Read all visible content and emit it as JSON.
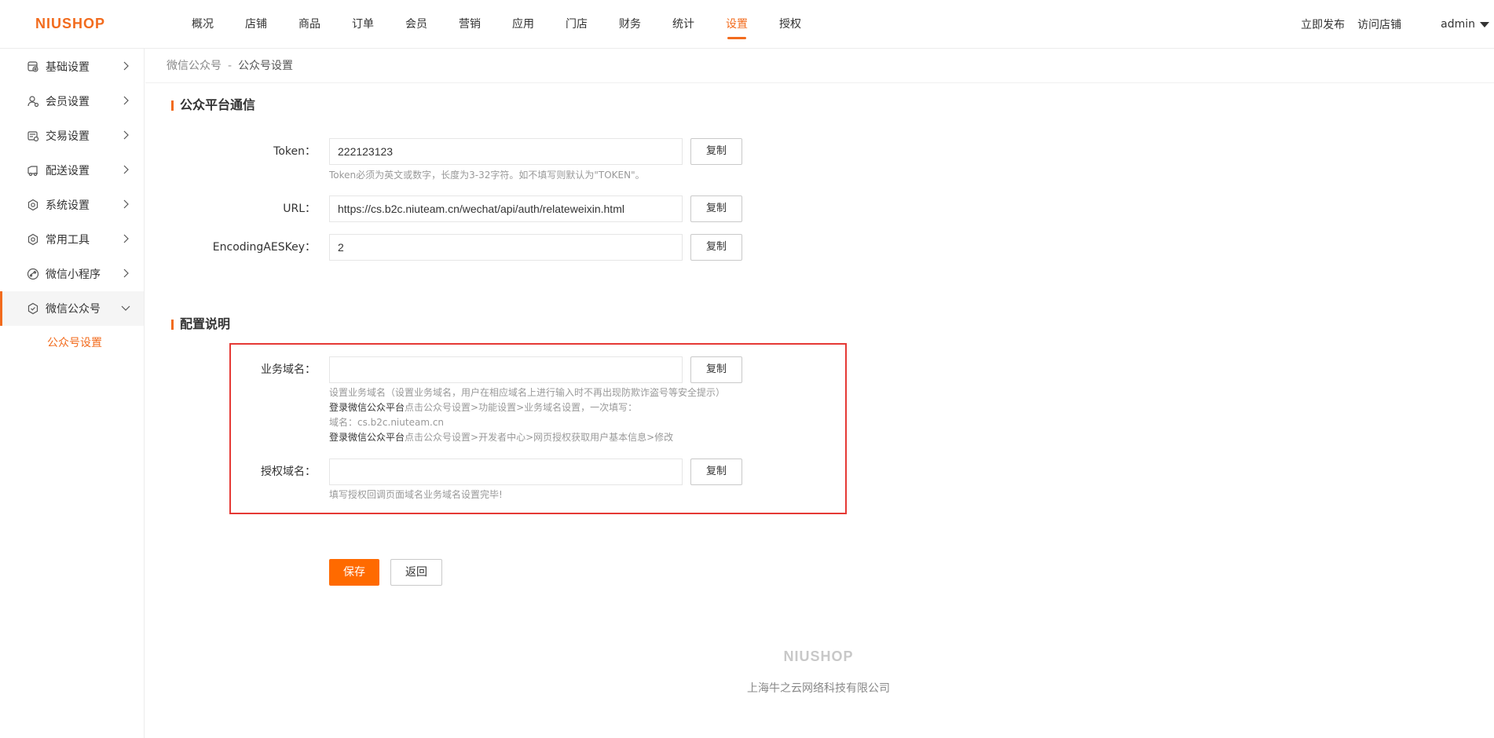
{
  "header": {
    "logo": "NIUSHOP",
    "nav": [
      "概况",
      "店铺",
      "商品",
      "订单",
      "会员",
      "营销",
      "应用",
      "门店",
      "财务",
      "统计",
      "设置",
      "授权"
    ],
    "active_nav": "设置",
    "publish": "立即发布",
    "visit_store": "访问店铺",
    "user": "admin"
  },
  "sidebar": {
    "items": [
      {
        "label": "基础设置",
        "icon": "basic-settings-icon"
      },
      {
        "label": "会员设置",
        "icon": "member-icon"
      },
      {
        "label": "交易设置",
        "icon": "trade-icon"
      },
      {
        "label": "配送设置",
        "icon": "delivery-icon"
      },
      {
        "label": "系统设置",
        "icon": "gear-icon"
      },
      {
        "label": "常用工具",
        "icon": "tools-icon"
      },
      {
        "label": "微信小程序",
        "icon": "mini-program-icon"
      },
      {
        "label": "微信公众号",
        "icon": "wechat-official-icon"
      }
    ],
    "sub_item": "公众号设置"
  },
  "breadcrumb": {
    "parent": "微信公众号",
    "separator": "-",
    "current": "公众号设置"
  },
  "section1": {
    "title": "公众平台通信",
    "token_label": "Token：",
    "token_value": "222123123",
    "token_hint": "Token必须为英文或数字，长度为3-32字符。如不填写则默认为\"TOKEN\"。",
    "url_label": "URL：",
    "url_value": "https://cs.b2c.niuteam.cn/wechat/api/auth/relateweixin.html",
    "aes_label": "EncodingAESKey：",
    "aes_value": "2",
    "copy_label": "复制"
  },
  "section2": {
    "title": "配置说明",
    "business_domain_label": "业务域名：",
    "business_domain_value": "",
    "business_hint_1": "设置业务域名（设置业务域名，用户在相应域名上进行输入时不再出现防欺诈盗号等安全提示）",
    "business_hint_2_bold": "登录微信公众平台",
    "business_hint_2_rest": "点击公众号设置>功能设置>业务域名设置，一次填写：",
    "business_hint_3": "域名：cs.b2c.niuteam.cn",
    "business_hint_4_bold": "登录微信公众平台",
    "business_hint_4_rest": "点击公众号设置>开发者中心>网页授权获取用户基本信息>修改",
    "auth_domain_label": "授权域名：",
    "auth_domain_value": "",
    "auth_hint": "填写授权回调页面域名业务域名设置完毕!",
    "copy_label": "复制"
  },
  "actions": {
    "save": "保存",
    "back": "返回"
  },
  "footer": {
    "logo": "NIUSHOP",
    "company": "上海牛之云网络科技有限公司"
  },
  "colors": {
    "accent": "#f26b1d",
    "highlight_box": "#e53935",
    "save_bg": "#ff6a00"
  }
}
